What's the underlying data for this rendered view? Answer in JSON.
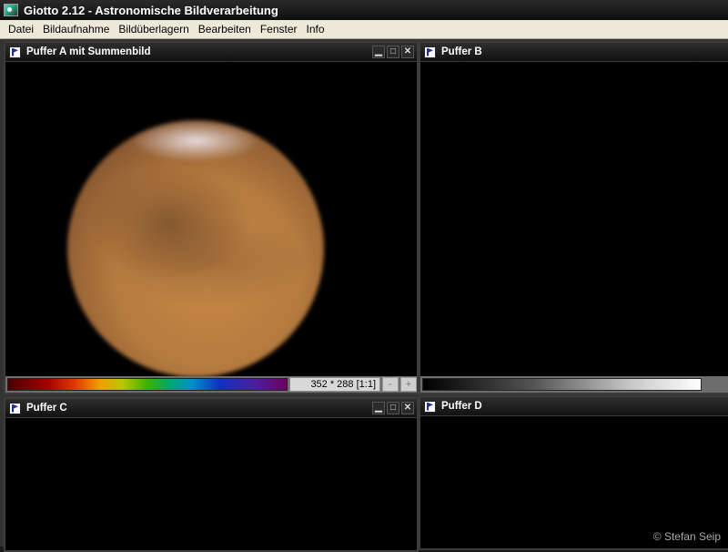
{
  "app": {
    "title": "Giotto 2.12 - Astronomische Bildverarbeitung"
  },
  "menu": [
    "Datei",
    "Bildaufnahme",
    "Bildüberlagern",
    "Bearbeiten",
    "Fenster",
    "Info"
  ],
  "windows": {
    "a": {
      "title": "Puffer A mit Summenbild",
      "image_size": "352 * 288 [1:1]",
      "zoom_out": "-",
      "zoom_in": "+"
    },
    "b": {
      "title": "Puffer B"
    },
    "c": {
      "title": "Puffer C"
    },
    "d": {
      "title": "Puffer D"
    }
  },
  "buttons": {
    "minimize": "▁",
    "maximize": "□",
    "close": "✕"
  },
  "copyright": "© Stefan Seip",
  "colors": {
    "background": "#000000",
    "titlebar": "#1a1a1a",
    "menubar": "#ece9d8"
  }
}
